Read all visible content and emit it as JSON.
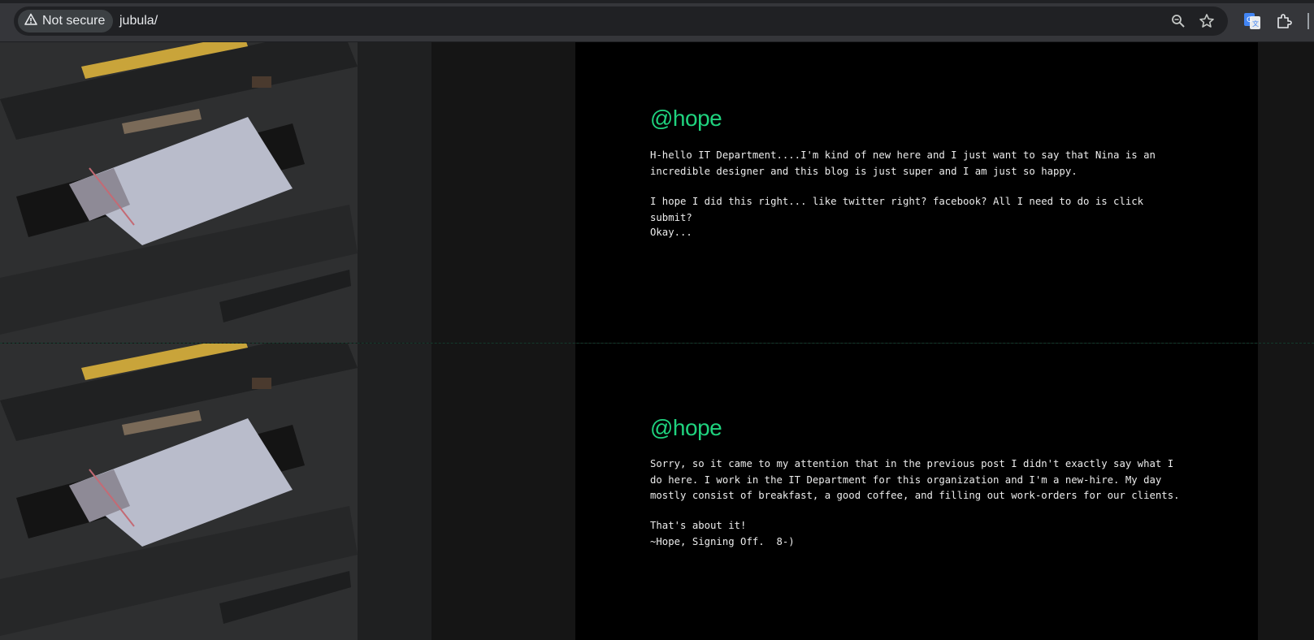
{
  "browser": {
    "security_label": "Not secure",
    "url": "jubula/",
    "icons": [
      "warning-icon",
      "zoom-icon",
      "bookmark-star-icon",
      "translate-icon",
      "extensions-icon"
    ]
  },
  "posts": [
    {
      "handle": "@hope",
      "paragraphs": [
        "H-hello IT Department....I'm kind of new here and I just want to say that Nina is an incredible designer and this blog is just super and I am just so happy.",
        "I hope I did this right... like twitter right? facebook? All I need to do is click submit?",
        "Okay..."
      ]
    },
    {
      "handle": "@hope",
      "paragraphs": [
        "Sorry, so it came to my attention that in the previous post I didn't exactly say what I do here. I work in the IT Department for this organization and I'm a new-hire. My day mostly consist of breakfast, a good coffee, and filling out work-orders for our clients.",
        "That's about it!\n~Hope, Signing Off.  8-)"
      ]
    }
  ],
  "colors": {
    "handle": "#1fd27e",
    "text": "#ececec",
    "content_bg": "#000000",
    "side_bg": "#151515"
  }
}
